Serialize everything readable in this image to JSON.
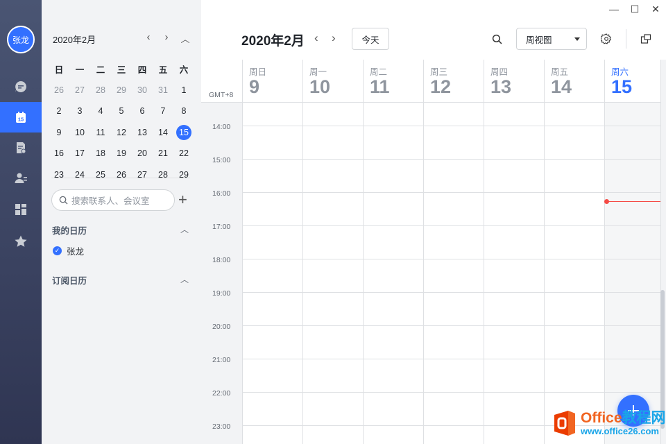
{
  "window": {
    "minimize": "—",
    "maximize": "☐",
    "close": "✕"
  },
  "rail": {
    "avatar_text": "张龙",
    "items": [
      {
        "name": "chat-icon"
      },
      {
        "name": "calendar-icon",
        "badge": "15",
        "active": true
      },
      {
        "name": "docs-icon"
      },
      {
        "name": "contacts-icon"
      },
      {
        "name": "apps-icon"
      },
      {
        "name": "favorites-icon"
      }
    ]
  },
  "mini_calendar": {
    "title": "2020年2月",
    "weekdays": [
      "日",
      "一",
      "二",
      "三",
      "四",
      "五",
      "六"
    ],
    "weeks": [
      [
        "26",
        "27",
        "28",
        "29",
        "30",
        "31",
        "1"
      ],
      [
        "2",
        "3",
        "4",
        "5",
        "6",
        "7",
        "8"
      ],
      [
        "9",
        "10",
        "11",
        "12",
        "13",
        "14",
        "15"
      ],
      [
        "16",
        "17",
        "18",
        "19",
        "20",
        "21",
        "22"
      ],
      [
        "23",
        "24",
        "25",
        "26",
        "27",
        "28",
        "29"
      ]
    ],
    "today": "15"
  },
  "search": {
    "placeholder": "搜索联系人、会议室"
  },
  "my_calendars": {
    "title": "我的日历",
    "items": [
      "张龙"
    ]
  },
  "subscribed": {
    "title": "订阅日历"
  },
  "header": {
    "title": "2020年2月",
    "today_label": "今天",
    "view_select": "周视图"
  },
  "week": {
    "gmt": "GMT+8",
    "days": [
      {
        "name": "周日",
        "num": "9"
      },
      {
        "name": "周一",
        "num": "10"
      },
      {
        "name": "周二",
        "num": "11"
      },
      {
        "name": "周三",
        "num": "12"
      },
      {
        "name": "周四",
        "num": "13"
      },
      {
        "name": "周五",
        "num": "14"
      },
      {
        "name": "周六",
        "num": "15",
        "today": true
      }
    ],
    "times": [
      "14:00",
      "15:00",
      "16:00",
      "17:00",
      "18:00",
      "19:00",
      "20:00",
      "21:00",
      "22:00",
      "23:00"
    ]
  },
  "watermark": {
    "brand": "Office",
    "brand2": "教程网",
    "url": "www.office26.com"
  },
  "colors": {
    "accent": "#3370ff",
    "now_line": "#f54a45"
  }
}
